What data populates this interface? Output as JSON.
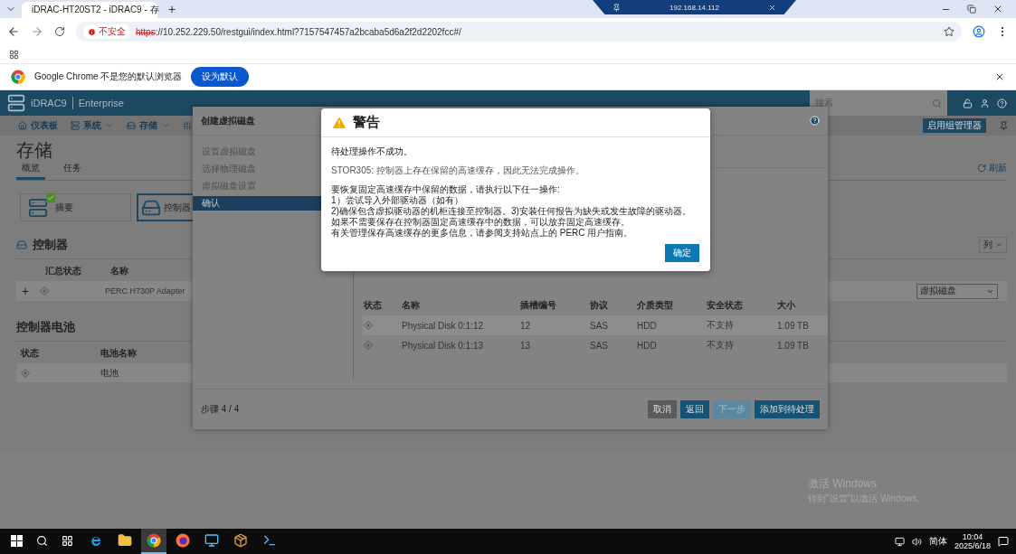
{
  "browser": {
    "tab_title": "iDRAC-HT20ST2 - iDRAC9 - 存",
    "new_tab": "+",
    "security_badge": "不安全",
    "url_scheme": "https",
    "url_rest": "://10.252.229.50/restgui/index.html?7157547457a2bcaba5d6a2f2d2202fcc#/"
  },
  "remote_bar": {
    "host": "192.168.14.112"
  },
  "infobar": {
    "message": "Google Chrome 不是您的默认浏览器",
    "button": "设为默认"
  },
  "idrac": {
    "brand": "iDRAC9",
    "edition": "Enterprise",
    "search": {
      "placeholder": "搜索"
    },
    "nav": [
      {
        "label": "仪表板",
        "menu": false
      },
      {
        "label": "系统",
        "menu": true
      },
      {
        "label": "存储",
        "menu": true
      }
    ],
    "group_manager_button": "启用组管理器",
    "title": "存储",
    "tabs": [
      {
        "label": "概览",
        "selected": true
      },
      {
        "label": "任务",
        "selected": false
      }
    ],
    "refresh": "刷新",
    "cards": [
      {
        "label": "摘要",
        "selected": false,
        "ok": true
      },
      {
        "label": "控制器",
        "selected": true,
        "ok": false
      }
    ],
    "controllers": {
      "title": "控制器",
      "columns_button": "列",
      "columns": [
        "汇总状态",
        "名称"
      ],
      "rows": [
        {
          "expand": "+",
          "name": "PERC H730P Adapter",
          "select": "虚拟磁盘"
        }
      ]
    },
    "battery": {
      "title": "控制器电池",
      "columns": [
        "状态",
        "电池名称"
      ],
      "rows": [
        {
          "name": "电池"
        }
      ]
    }
  },
  "dialog": {
    "title": "创建虚拟磁盘",
    "steps": [
      {
        "label": "设置虚拟磁盘",
        "selected": false
      },
      {
        "label": "选择物理磁盘",
        "selected": false
      },
      {
        "label": "虚拟磁盘设置",
        "selected": false
      },
      {
        "label": "确认",
        "selected": true
      }
    ],
    "disks": {
      "columns": [
        "状态",
        "名称",
        "插槽编号",
        "协议",
        "介质类型",
        "安全状态",
        "大小"
      ],
      "rows": [
        {
          "name": "Physical Disk 0:1:12",
          "slot": "12",
          "protocol": "SAS",
          "media": "HDD",
          "security": "不支持",
          "size": "1.09 TB"
        },
        {
          "name": "Physical Disk 0:1:13",
          "slot": "13",
          "protocol": "SAS",
          "media": "HDD",
          "security": "不支持",
          "size": "1.09 TB"
        }
      ]
    },
    "step_counter": "步骤 4 / 4",
    "buttons": [
      {
        "label": "取消",
        "kind": "cancel",
        "disabled": false
      },
      {
        "label": "返回",
        "kind": "primary",
        "disabled": false
      },
      {
        "label": "下一步",
        "kind": "primary",
        "disabled": true
      },
      {
        "label": "添加到待处理",
        "kind": "primary",
        "disabled": false
      }
    ]
  },
  "alert": {
    "title": "警告",
    "paragraphs": [
      [
        "待处理操作不成功。"
      ],
      [
        "STOR305: 控制器上存在保留的高速缓存，因此无法完成操作。"
      ],
      [
        "要恢复固定高速缓存中保留的数据，请执行以下任一操作:",
        "1）尝试导入外部驱动器（如有）",
        "2)确保包含虚拟驱动器的机柜连接至控制器。3)安装任何报告为缺失或发生故障的驱动器。",
        "如果不需要保存在控制器固定高速缓存中的数据，可以放弃固定高速缓存。",
        "有关管理保存高速缓存的更多信息，请参阅支持站点上的 PERC 用户指南。"
      ]
    ],
    "button": "确定"
  },
  "desktop": {
    "watermark_title": "激活 Windows",
    "watermark_hint": "转到\"设置\"以激活 Windows。"
  },
  "taskbar": {
    "apps": [
      {
        "kind": "ie",
        "selected": false
      },
      {
        "kind": "folder",
        "selected": false
      },
      {
        "kind": "chrome",
        "selected": true
      },
      {
        "kind": "firefox",
        "selected": false
      },
      {
        "kind": "monitor",
        "selected": false
      },
      {
        "kind": "package",
        "selected": false
      },
      {
        "kind": "console",
        "selected": false
      }
    ],
    "ime": "简体",
    "time": "10:04",
    "date": "2025/6/18"
  }
}
